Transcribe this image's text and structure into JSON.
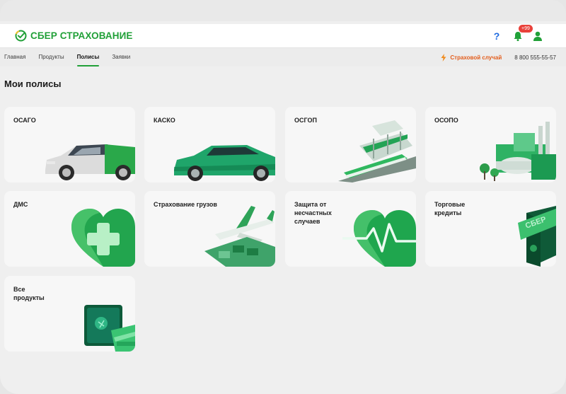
{
  "header": {
    "brand": "СБЕР СТРАХОВАНИЕ",
    "help_label": "?",
    "notifications_badge": "+99",
    "brand_color": "#21a038"
  },
  "nav": {
    "tabs": [
      {
        "label": "Главная",
        "active": false
      },
      {
        "label": "Продукты",
        "active": false
      },
      {
        "label": "Полисы",
        "active": true
      },
      {
        "label": "Заявки",
        "active": false
      }
    ],
    "insurance_case": "Страховой случай",
    "phone": "8 800 555-55-57"
  },
  "page": {
    "title": "Мои полисы"
  },
  "cards": [
    {
      "label": "ОСАГО",
      "icon": "car-white-icon"
    },
    {
      "label": "КАСКО",
      "icon": "car-green-icon"
    },
    {
      "label": "ОСГОП",
      "icon": "train-station-icon"
    },
    {
      "label": "ОСОПО",
      "icon": "industrial-plant-icon"
    },
    {
      "label": "ДМС",
      "icon": "heart-cross-icon"
    },
    {
      "label": "Страхование грузов",
      "icon": "cargo-plane-icon"
    },
    {
      "label": "Защита от\nнесчастных\nслучаев",
      "icon": "heart-pulse-icon"
    },
    {
      "label": "Торговые\nкредиты",
      "icon": "card-safe-icon"
    },
    {
      "label": "Все\nпродукты",
      "icon": "safe-cards-icon"
    }
  ]
}
